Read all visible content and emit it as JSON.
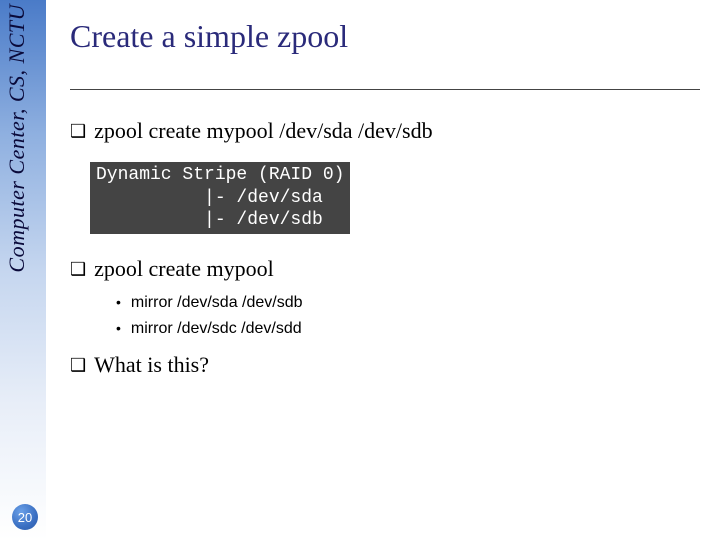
{
  "sidebar": {
    "org_text": "Computer Center, CS, NCTU"
  },
  "page_number": "20",
  "title": "Create a simple zpool",
  "bullets": [
    {
      "text": "zpool create mypool /dev/sda /dev/sdb",
      "code": "Dynamic Stripe (RAID 0)\n          |- /dev/sda\n          |- /dev/sdb",
      "subs": []
    },
    {
      "text": "zpool create mypool",
      "code": null,
      "subs": [
        "mirror /dev/sda /dev/sdb",
        "mirror /dev/sdc /dev/sdd"
      ]
    },
    {
      "text": "What is this?",
      "code": null,
      "subs": []
    }
  ]
}
